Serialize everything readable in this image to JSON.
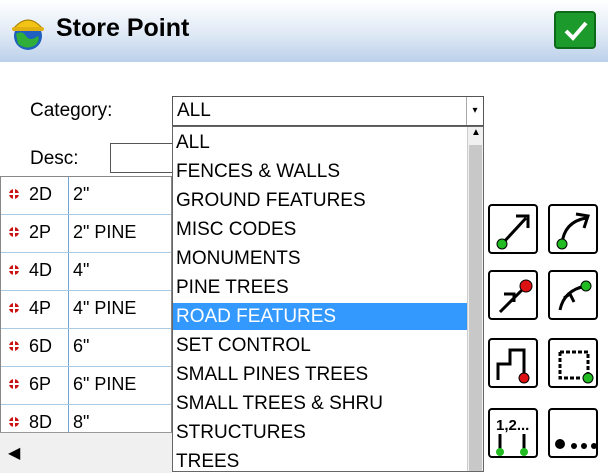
{
  "header": {
    "title": "Store Point"
  },
  "form": {
    "category_label": "Category:",
    "category_value": "ALL",
    "desc_label": "Desc:"
  },
  "dropdown": {
    "options": [
      "ALL",
      "FENCES & WALLS",
      "GROUND FEATURES",
      "MISC CODES",
      "MONUMENTS",
      "PINE TREES",
      "ROAD FEATURES",
      "SET CONTROL",
      "SMALL PINES TREES",
      "SMALL TREES & SHRU",
      "STRUCTURES",
      "TREES"
    ],
    "selected": "ROAD FEATURES"
  },
  "code_list": [
    {
      "code": "2D",
      "desc": "2\""
    },
    {
      "code": "2P",
      "desc": "2\" PINE"
    },
    {
      "code": "4D",
      "desc": "4\""
    },
    {
      "code": "4P",
      "desc": "4\" PINE"
    },
    {
      "code": "6D",
      "desc": "6\""
    },
    {
      "code": "6P",
      "desc": "6\" PINE"
    },
    {
      "code": "8D",
      "desc": "8\""
    }
  ],
  "colors": {
    "accent": "#1c9a2c",
    "selection": "#3399ff",
    "pin": "#cc1111",
    "node_green": "#22bb22",
    "node_red": "#dd1111"
  },
  "icons": [
    "store-point-logo",
    "check-icon",
    "line-start-icon",
    "curve-start-icon",
    "line-end-icon",
    "curve-end-icon",
    "polygon-close-icon",
    "rectangle-close-icon",
    "sequence-icon",
    "points-icon"
  ]
}
